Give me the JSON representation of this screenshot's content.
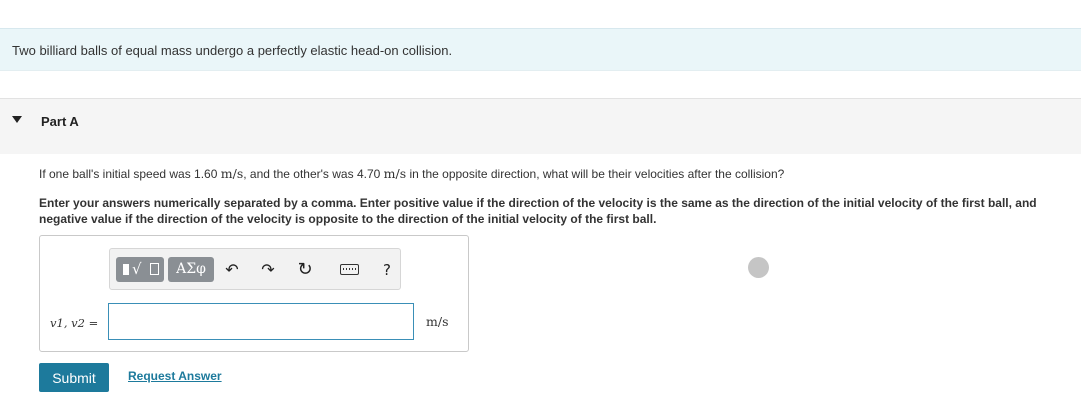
{
  "problem": {
    "text": "Two billiard balls of equal mass undergo a perfectly elastic head-on collision."
  },
  "part": {
    "title": "Part A",
    "question": {
      "prefix": "If one ball's initial speed was ",
      "speed1": "1.60",
      "unit1": "m/s",
      "middle": ", and the other's was ",
      "speed2": "4.70",
      "unit2": "m/s",
      "suffix": " in the opposite direction, what will be their velocities after the collision?"
    },
    "instructions": "Enter your answers numerically separated by a comma. Enter positive value if the direction of the velocity is the same as the direction of the initial velocity of the first ball, and negative value if the direction of the velocity is opposite to the direction of the initial velocity of the first ball."
  },
  "toolbar": {
    "greek_label": "ΑΣφ",
    "undo_icon": "↶",
    "redo_icon": "↷",
    "reset_icon": "↻",
    "help_label": "?",
    "icons": [
      "templates-icon",
      "greek-symbols-icon",
      "undo-icon",
      "redo-icon",
      "reset-icon",
      "keyboard-icon",
      "help-icon"
    ]
  },
  "answer": {
    "variable_label": "v1, v2 =",
    "value": "",
    "unit": "m/s"
  },
  "actions": {
    "submit_label": "Submit",
    "request_answer_label": "Request Answer"
  },
  "colors": {
    "accent": "#1d7a9c",
    "banner_bg": "#eaf6f9",
    "input_border": "#3a8fb7",
    "status_dot": "#c5c5c5"
  }
}
